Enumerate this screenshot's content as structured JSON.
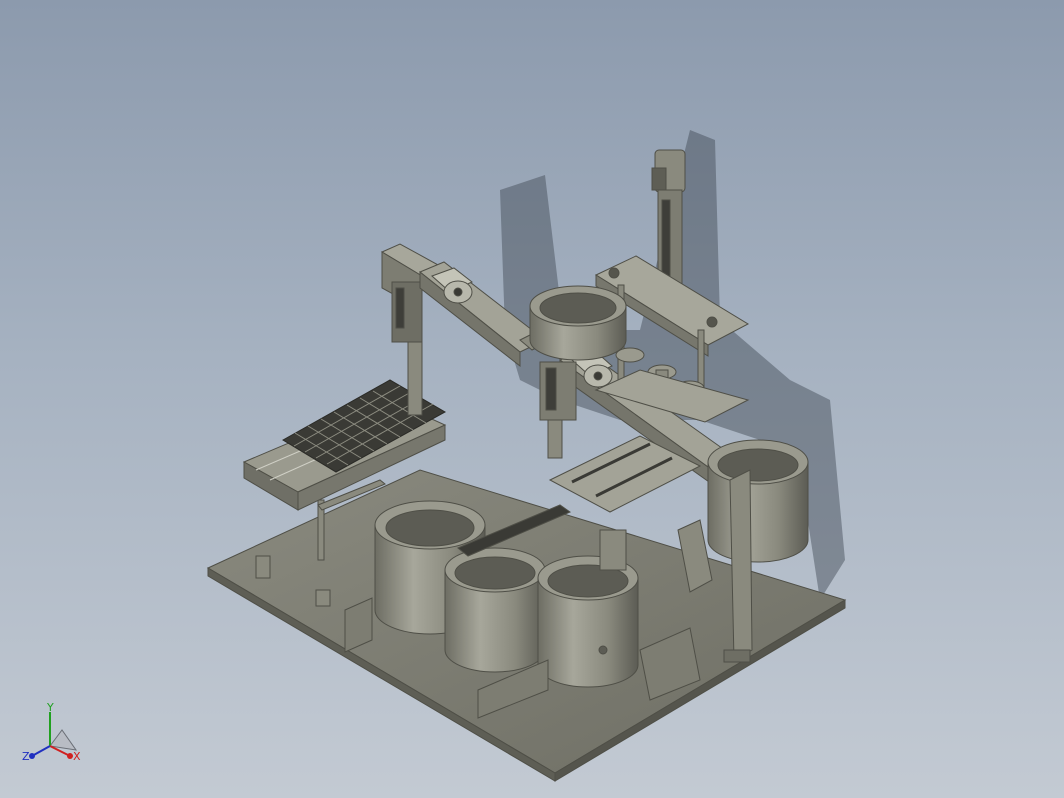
{
  "viewport": {
    "background_top": "#8c9aad",
    "background_bottom": "#c3cad3"
  },
  "triad": {
    "x_label": "X",
    "y_label": "Y",
    "z_label": "Z",
    "x_color": "#d02020",
    "y_color": "#20a020",
    "z_color": "#2030c0"
  },
  "model": {
    "steel_color": "#7d7d72",
    "steel_light": "#9a9a8e",
    "steel_dark": "#4f4f47",
    "shadow_color": "#3e4652"
  }
}
